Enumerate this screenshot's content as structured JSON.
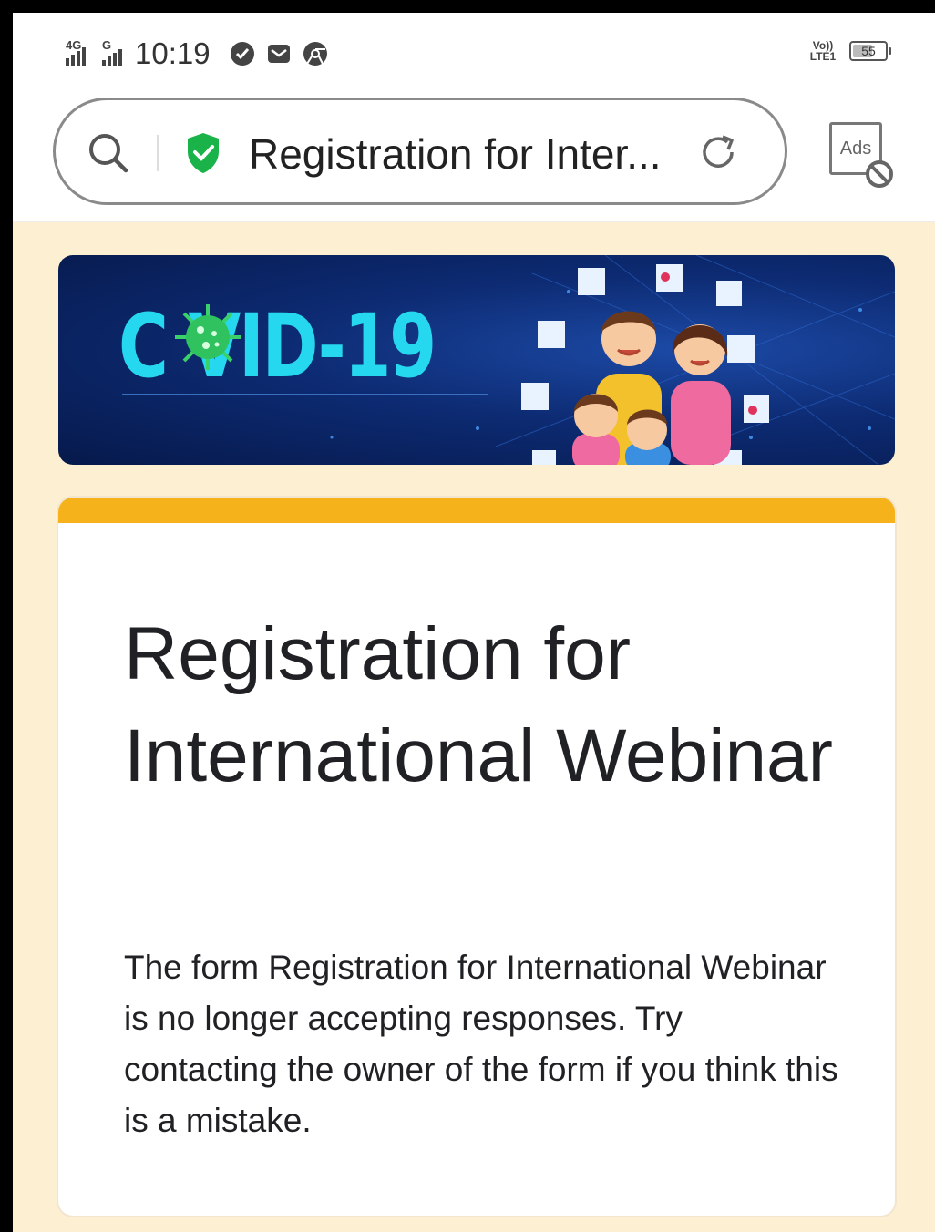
{
  "status_bar": {
    "network_1": "4G",
    "network_2": "G",
    "time": "10:19",
    "volte": "Vo)) LTE1",
    "battery": "55"
  },
  "browser": {
    "url_title": "Registration for Inter...",
    "ads_label": "Ads"
  },
  "banner": {
    "title": "C  VID-19"
  },
  "form": {
    "title": "Registration for International Webinar",
    "message": "The form Registration for International Webinar is no longer accepting responses. Try contacting the owner of the form if you think this is a mistake.",
    "accent_color": "#f6b21a"
  },
  "page": {
    "background_color": "#fdefd2"
  }
}
